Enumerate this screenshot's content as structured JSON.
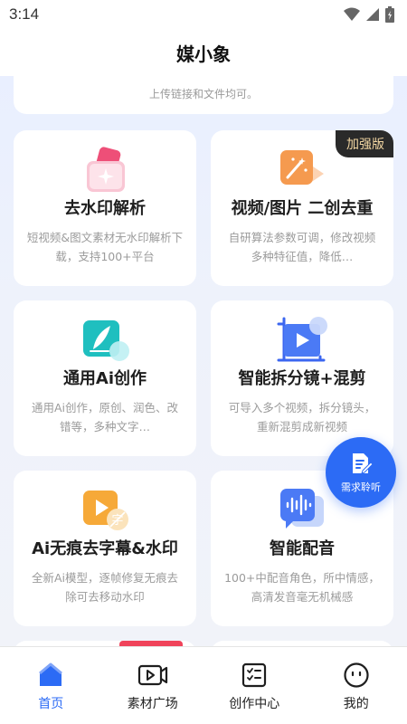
{
  "status_bar": {
    "time": "3:14"
  },
  "header": {
    "title": "媒小象"
  },
  "top_card": {
    "text": "上传链接和文件均可。"
  },
  "cards": [
    {
      "title": "去水印解析",
      "desc": "短视频&图文素材无水印解析下载，支持100+平台",
      "icon": "watermark-remove-icon",
      "badge": ""
    },
    {
      "title": "视频/图片 二创去重",
      "desc": "自研算法参数可调，修改视频多种特征值，降低…",
      "icon": "magic-wand-video-icon",
      "badge": "加强版"
    },
    {
      "title": "通用Ai创作",
      "desc": "通用Ai创作，原创、润色、改错等，多种文字…",
      "icon": "ai-writing-icon",
      "badge": ""
    },
    {
      "title": "智能拆分镜+混剪",
      "desc": "可导入多个视频，拆分镜头，重新混剪成新视频",
      "icon": "video-split-icon",
      "badge": ""
    },
    {
      "title": "Ai无痕去字幕&水印",
      "desc": "全新Ai模型，逐帧修复无痕去除可去移动水印",
      "icon": "subtitle-remove-icon",
      "badge": ""
    },
    {
      "title": "智能配音",
      "desc": "100+中配音角色，所中情感，高清发音毫无机械感",
      "icon": "voice-dubbing-icon",
      "badge": ""
    }
  ],
  "fab": {
    "label": "需求聆听"
  },
  "nav": [
    {
      "label": "首页",
      "icon": "home-icon",
      "active": true
    },
    {
      "label": "素材广场",
      "icon": "video-play-icon",
      "active": false
    },
    {
      "label": "创作中心",
      "icon": "checklist-icon",
      "active": false
    },
    {
      "label": "我的",
      "icon": "face-icon",
      "active": false
    }
  ],
  "colors": {
    "accent": "#2c6bf5",
    "badge_bg": "#2a2a2a",
    "badge_text": "#f3d7a3"
  }
}
